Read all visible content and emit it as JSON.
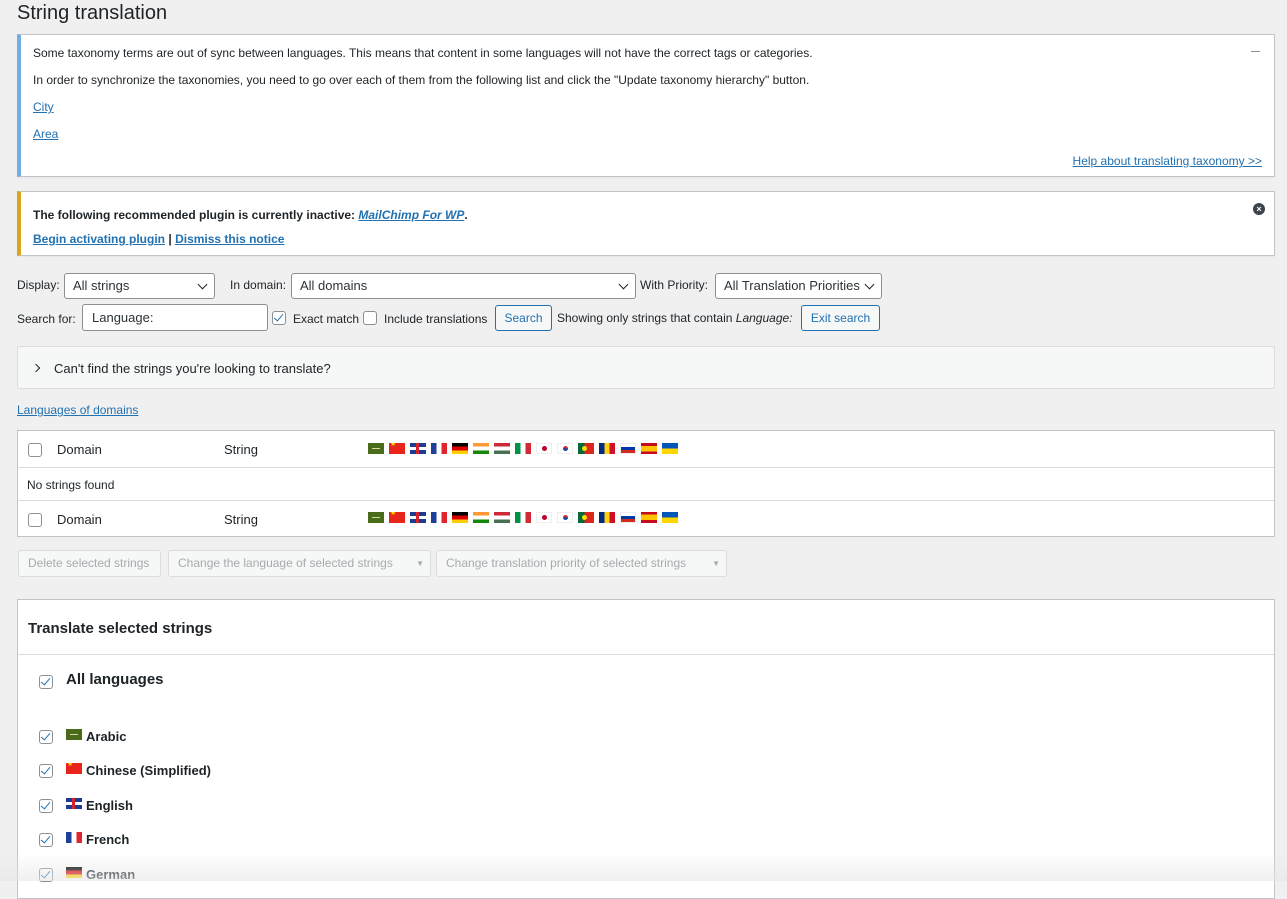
{
  "page": {
    "title": "String translation"
  },
  "taxonomy_notice": {
    "line1": "Some taxonomy terms are out of sync between languages. This means that content in some languages will not have the correct tags or categories.",
    "line2": "In order to synchronize the taxonomies, you need to go over each of them from the following list and click the \"Update taxonomy hierarchy\" button.",
    "links": [
      "City",
      "Area"
    ],
    "help_link": "Help about translating taxonomy >>"
  },
  "plugin_notice": {
    "text_prefix": "The following recommended plugin is currently inactive: ",
    "plugin_name": "MailChimp For WP",
    "text_suffix": ".",
    "activate_link": "Begin activating plugin",
    "separator": "|",
    "dismiss_link": "Dismiss this notice",
    "close_icon": "×"
  },
  "filters": {
    "display_label": "Display:",
    "display_value": "All strings",
    "domain_label": "In domain:",
    "domain_value": "All domains",
    "priority_label": "With Priority:",
    "priority_value": "All Translation Priorities",
    "search_label": "Search for:",
    "search_value": "Language:",
    "exact_match_label": "Exact match",
    "exact_match_checked": true,
    "include_translations_label": "Include translations",
    "include_translations_checked": false,
    "search_button": "Search",
    "showing_prefix": "Showing only strings that contain ",
    "showing_term": "Language:",
    "exit_search_button": "Exit search"
  },
  "accordion": {
    "label": "Can't find the strings you're looking to translate?"
  },
  "languages_of_domains_link": "Languages of domains",
  "table": {
    "col_domain": "Domain",
    "col_string": "String",
    "empty_message": "No strings found",
    "flags": [
      "arabic",
      "chinese",
      "english",
      "french",
      "german",
      "hindi",
      "hungarian",
      "italian",
      "japanese",
      "korean",
      "portuguese",
      "romanian",
      "russian",
      "spanish",
      "ukrainian"
    ]
  },
  "bulk_actions": {
    "delete": "Delete selected strings",
    "change_language": "Change the language of selected strings",
    "change_priority": "Change translation priority of selected strings"
  },
  "translate_box": {
    "title": "Translate selected strings",
    "all_languages_label": "All languages",
    "languages": [
      {
        "name": "Arabic",
        "flag": "arabic",
        "checked": true
      },
      {
        "name": "Chinese (Simplified)",
        "flag": "chinese",
        "checked": true
      },
      {
        "name": "English",
        "flag": "english",
        "checked": true
      },
      {
        "name": "French",
        "flag": "french",
        "checked": true
      },
      {
        "name": "German",
        "flag": "german",
        "checked": true
      }
    ]
  },
  "colors": {
    "link": "#2271b1",
    "info_border": "#72aee6",
    "warning_border": "#dba617",
    "background": "#f0f0f1"
  }
}
